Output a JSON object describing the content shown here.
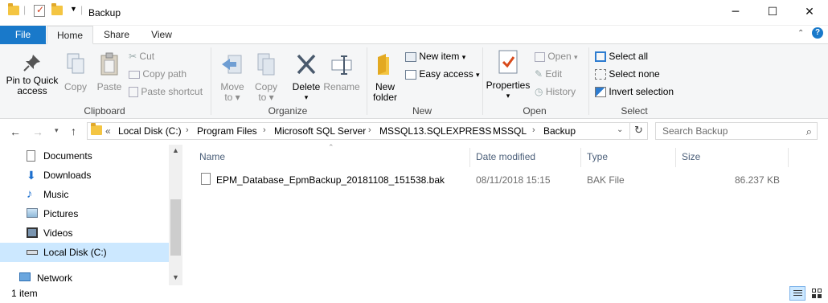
{
  "window": {
    "title": "Backup",
    "controls": {
      "minimize": "─",
      "maximize": "☐",
      "close": "✕"
    }
  },
  "ribbon_tabs": [
    "File",
    "Home",
    "Share",
    "View"
  ],
  "ribbon": {
    "clipboard": {
      "label": "Clipboard",
      "pin": "Pin to Quick",
      "pin2": "access",
      "copy": "Copy",
      "paste": "Paste",
      "cut": "Cut",
      "copy_path": "Copy path",
      "paste_shortcut": "Paste shortcut"
    },
    "organize": {
      "label": "Organize",
      "move_to": "Move",
      "move_to2": "to",
      "copy_to": "Copy",
      "copy_to2": "to",
      "delete": "Delete",
      "rename": "Rename"
    },
    "new": {
      "label": "New",
      "new_folder": "New",
      "new_folder2": "folder",
      "new_item": "New item",
      "easy_access": "Easy access"
    },
    "open": {
      "label": "Open",
      "properties": "Properties",
      "open": "Open",
      "edit": "Edit",
      "history": "History"
    },
    "select": {
      "label": "Select",
      "select_all": "Select all",
      "select_none": "Select none",
      "invert": "Invert selection"
    }
  },
  "address": {
    "overflow": "«",
    "crumbs": [
      "Local Disk (C:)",
      "Program Files",
      "Microsoft SQL Server",
      "MSSQL13.SQLEXPRESS",
      "MSSQL",
      "Backup"
    ],
    "search_placeholder": "Search Backup"
  },
  "nav": {
    "items": [
      "Documents",
      "Downloads",
      "Music",
      "Pictures",
      "Videos",
      "Local Disk (C:)"
    ],
    "network": "Network",
    "selected": "Local Disk (C:)"
  },
  "columns": [
    "Name",
    "Date modified",
    "Type",
    "Size"
  ],
  "files": [
    {
      "name": "EPM_Database_EpmBackup_20181108_151538.bak",
      "date": "08/11/2018 15:15",
      "type": "BAK File",
      "size": "86.237 KB"
    }
  ],
  "status": {
    "count": "1 item"
  },
  "colors": {
    "accent": "#1979ca",
    "selection": "#cce8ff",
    "folder": "#f4c542"
  }
}
